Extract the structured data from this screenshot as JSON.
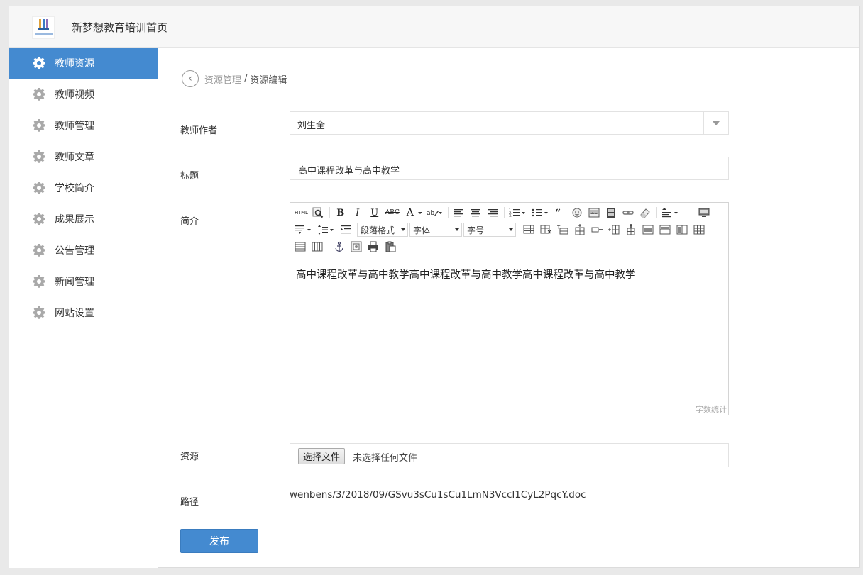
{
  "header": {
    "app_title": "新梦想教育培训首页"
  },
  "sidebar": {
    "items": [
      {
        "label": "教师资源",
        "active": true
      },
      {
        "label": "教师视频"
      },
      {
        "label": "教师管理"
      },
      {
        "label": "教师文章"
      },
      {
        "label": "学校简介"
      },
      {
        "label": "成果展示"
      },
      {
        "label": "公告管理"
      },
      {
        "label": "新闻管理"
      },
      {
        "label": "网站设置"
      }
    ]
  },
  "breadcrumb": {
    "parent": "资源管理",
    "separator": "/",
    "current": "资源编辑"
  },
  "form": {
    "author_label": "教师作者",
    "author_value": "刘生全",
    "title_label": "标题",
    "title_value": "高中课程改革与高中教学",
    "intro_label": "简介",
    "resource_label": "资源",
    "path_label": "路径",
    "path_value": "wenbens/3/2018/09/GSvu3sCu1sCu1LmN3Vccl1CyL2PqcY.doc",
    "publish_label": "发布"
  },
  "editor": {
    "toolbar": {
      "html_label": "HTML",
      "bold": "B",
      "italic": "I",
      "underline": "U",
      "strike": "ABC",
      "font_color": "A",
      "paragraph_format": "段落格式",
      "font_family": "字体",
      "font_size": "字号"
    },
    "content": "高中课程改革与高中教学高中课程改革与高中教学高中课程改革与高中教学",
    "word_count_label": "字数统计"
  },
  "file_input": {
    "button_label": "选择文件",
    "status": "未选择任何文件"
  },
  "colors": {
    "accent": "#448ad0"
  }
}
